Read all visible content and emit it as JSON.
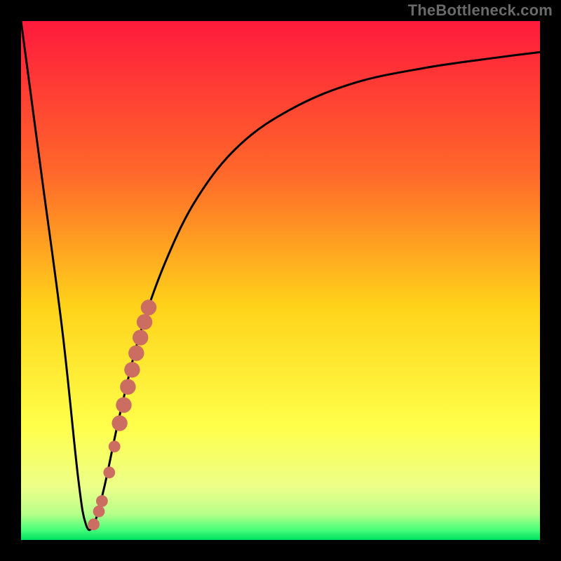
{
  "watermark": "TheBottleneck.com",
  "colors": {
    "frame": "#000000",
    "gradient_top": "#ff1a3c",
    "gradient_mid1": "#ff6a2a",
    "gradient_mid2": "#ffd31a",
    "gradient_mid3": "#ffff4a",
    "gradient_mid4": "#ecff8a",
    "gradient_green1": "#b6ff8a",
    "gradient_green2": "#4aff7a",
    "gradient_bottom": "#00e060",
    "curve": "#000000",
    "dots": "#cc6d62"
  },
  "chart_data": {
    "type": "line",
    "title": "",
    "xlabel": "",
    "ylabel": "",
    "xlim": [
      0,
      100
    ],
    "ylim": [
      0,
      100
    ],
    "series": [
      {
        "name": "bottleneck-curve",
        "x": [
          0,
          4,
          8,
          11,
          12.5,
          14,
          16,
          19,
          23,
          28,
          34,
          42,
          52,
          64,
          78,
          92,
          100
        ],
        "y": [
          100,
          70,
          40,
          12,
          3,
          3,
          10,
          24,
          40,
          54,
          66,
          76,
          83,
          88,
          91,
          93,
          94
        ]
      }
    ],
    "scatter": [
      {
        "name": "highlight-dots",
        "points": [
          {
            "x": 14.0,
            "y": 3.0,
            "r": 1.2
          },
          {
            "x": 15.0,
            "y": 5.5,
            "r": 1.2
          },
          {
            "x": 15.6,
            "y": 7.5,
            "r": 1.2
          },
          {
            "x": 17.0,
            "y": 13.0,
            "r": 1.2
          },
          {
            "x": 18.0,
            "y": 18.0,
            "r": 1.2
          },
          {
            "x": 19.0,
            "y": 22.5,
            "r": 1.6
          },
          {
            "x": 19.8,
            "y": 26.0,
            "r": 1.6
          },
          {
            "x": 20.6,
            "y": 29.5,
            "r": 1.6
          },
          {
            "x": 21.4,
            "y": 32.8,
            "r": 1.6
          },
          {
            "x": 22.2,
            "y": 36.0,
            "r": 1.6
          },
          {
            "x": 23.0,
            "y": 39.0,
            "r": 1.6
          },
          {
            "x": 23.8,
            "y": 42.0,
            "r": 1.6
          },
          {
            "x": 24.6,
            "y": 44.8,
            "r": 1.6
          }
        ]
      }
    ]
  }
}
